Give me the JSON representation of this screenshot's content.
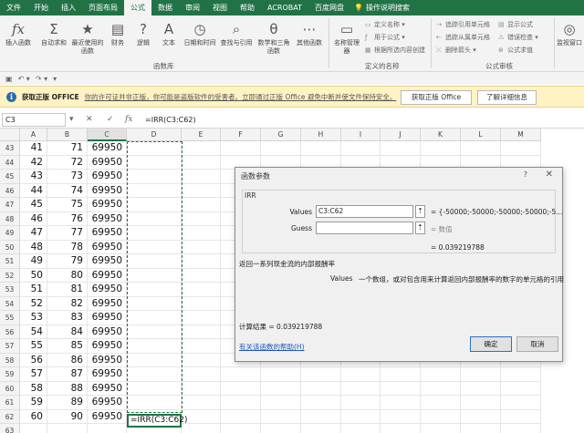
{
  "ribbon_tabs": [
    "文件",
    "开始",
    "插入",
    "页面布局",
    "公式",
    "数据",
    "审阅",
    "视图",
    "帮助",
    "ACROBAT",
    "百度网盘"
  ],
  "active_tab": "公式",
  "tell_me": "操作说明搜索",
  "ribbon": {
    "insert_fn": "插入函数",
    "autosum": "自动求和",
    "recent": "最近使用的函数",
    "financial": "财务",
    "logical": "逻辑",
    "text": "文本",
    "datetime": "日期和时间",
    "lookup": "查找与引用",
    "math": "数学和三角函数",
    "more": "其他函数",
    "group_library": "函数库",
    "name_mgr": "名称管理器",
    "define_name": "定义名称",
    "use_in_formula": "用于公式",
    "create_from_sel": "根据所选内容创建",
    "group_names": "定义的名称",
    "trace_prec": "追踪引用单元格",
    "trace_dep": "追踪从属单元格",
    "remove_arrows": "删除箭头",
    "show_formulas": "显示公式",
    "error_check": "错误检查",
    "eval_formula": "公式求值",
    "group_audit": "公式审核",
    "watch": "监视窗口"
  },
  "notice": {
    "title": "获取正版 OFFICE",
    "message": "你的许可证并非正版，你可能是盗版软件的受害者。立即通过正版 Office 避免中断并使文件保持安全。",
    "btn_get": "获取正版 Office",
    "btn_more": "了解详细信息"
  },
  "formula_bar": {
    "name_box": "C3",
    "formula": "=IRR(C3:C62)"
  },
  "columns": [
    "A",
    "B",
    "C",
    "D",
    "E",
    "F",
    "G",
    "H",
    "I",
    "J",
    "K",
    "L",
    "M"
  ],
  "rows": [
    {
      "n": "43",
      "a": "41",
      "b": "71",
      "c": "69950"
    },
    {
      "n": "44",
      "a": "42",
      "b": "72",
      "c": "69950"
    },
    {
      "n": "45",
      "a": "43",
      "b": "73",
      "c": "69950"
    },
    {
      "n": "46",
      "a": "44",
      "b": "74",
      "c": "69950"
    },
    {
      "n": "47",
      "a": "45",
      "b": "75",
      "c": "69950"
    },
    {
      "n": "48",
      "a": "46",
      "b": "76",
      "c": "69950"
    },
    {
      "n": "49",
      "a": "47",
      "b": "77",
      "c": "69950"
    },
    {
      "n": "50",
      "a": "48",
      "b": "78",
      "c": "69950"
    },
    {
      "n": "51",
      "a": "49",
      "b": "79",
      "c": "69950"
    },
    {
      "n": "52",
      "a": "50",
      "b": "80",
      "c": "69950"
    },
    {
      "n": "53",
      "a": "51",
      "b": "81",
      "c": "69950"
    },
    {
      "n": "54",
      "a": "52",
      "b": "82",
      "c": "69950"
    },
    {
      "n": "55",
      "a": "53",
      "b": "83",
      "c": "69950"
    },
    {
      "n": "56",
      "a": "54",
      "b": "84",
      "c": "69950"
    },
    {
      "n": "57",
      "a": "55",
      "b": "85",
      "c": "69950"
    },
    {
      "n": "58",
      "a": "56",
      "b": "86",
      "c": "69950"
    },
    {
      "n": "59",
      "a": "57",
      "b": "87",
      "c": "69950"
    },
    {
      "n": "60",
      "a": "58",
      "b": "88",
      "c": "69950"
    },
    {
      "n": "61",
      "a": "59",
      "b": "89",
      "c": "69950"
    },
    {
      "n": "62",
      "a": "60",
      "b": "90",
      "c": "69950"
    },
    {
      "n": "63",
      "a": "",
      "b": "",
      "c": ""
    }
  ],
  "edit_cell": "=IRR(C3:C62)",
  "dialog": {
    "title": "函数参数",
    "help_q": "?",
    "close": "✕",
    "function": "IRR",
    "arg1_label": "Values",
    "arg1_value": "C3:C62",
    "arg1_result": "= {-50000;-50000;-50000;-50000;-5...",
    "arg2_label": "Guess",
    "arg2_value": "",
    "arg2_result": "= 数值",
    "fn_result": "= 0.039219788",
    "description": "返回一系列现金流的内部报酬率",
    "arg_desc_name": "Values",
    "arg_desc_text": "一个数组，或对包含用来计算返回内部报酬率的数字的单元格的引用",
    "calc_result": "计算结果 =   0.039219788",
    "help_link": "有关该函数的帮助(H)",
    "ok": "确定",
    "cancel": "取消"
  },
  "colors": {
    "excel_green": "#217346",
    "notice_bg": "#fff3c4",
    "link": "#2255bb"
  }
}
